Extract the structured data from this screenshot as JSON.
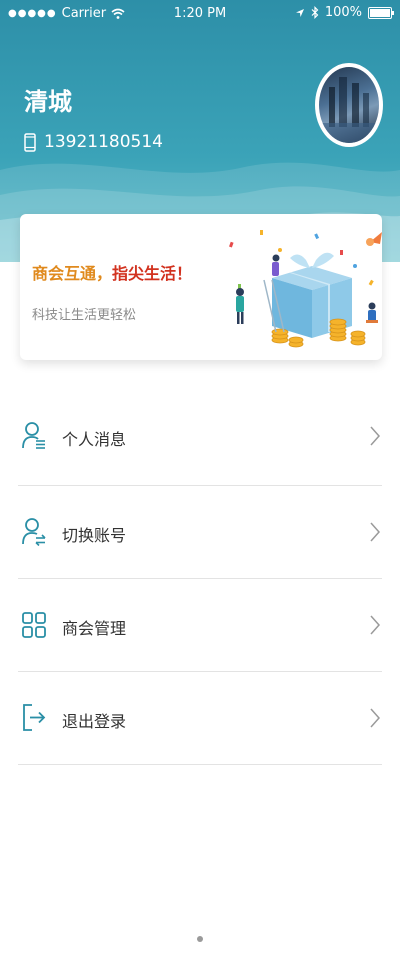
{
  "status_bar": {
    "carrier": "Carrier",
    "time": "1:20 PM",
    "battery": "100%"
  },
  "profile": {
    "name": "清城",
    "phone": "13921180514"
  },
  "banner": {
    "title_part1": "商会互通，",
    "title_part2": "指尖生活！",
    "subtitle": "科技让生活更轻松"
  },
  "menu": {
    "items": [
      {
        "label": "个人消息",
        "icon": "person-message-icon"
      },
      {
        "label": "切换账号",
        "icon": "switch-account-icon"
      },
      {
        "label": "商会管理",
        "icon": "grid-apps-icon"
      },
      {
        "label": "退出登录",
        "icon": "logout-icon"
      }
    ]
  },
  "colors": {
    "header": "#3ba3b8",
    "accent_icon": "#2a8fa6",
    "title_orange": "#e08a1e",
    "title_red": "#d2321f"
  }
}
